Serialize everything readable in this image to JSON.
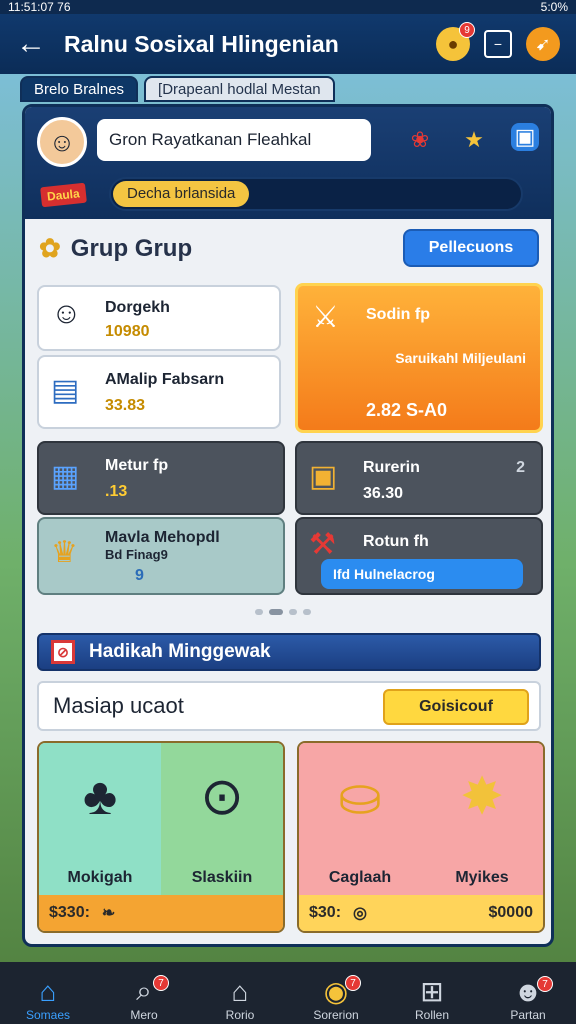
{
  "statusbar": {
    "left": "11:51:07 76",
    "right": "5:0%"
  },
  "appbar": {
    "title": "Ralnu Sosixal Hlingenian",
    "notif_count": "9"
  },
  "tabs": [
    "Brelo Bralnes",
    "[Drapeanl hodlal Mestan"
  ],
  "profile": {
    "name_value": "Gron Rayatkanan Fleahkal"
  },
  "status_pill": "Decha brlansida",
  "tag": "Daula",
  "group": {
    "title": "Grup Grup",
    "button": "Pellecuons"
  },
  "cards": {
    "c1": {
      "label": "Dorgekh",
      "value": "10980"
    },
    "c2": {
      "label": "AMalip Fabsarn",
      "value": "33.83"
    },
    "c3": {
      "label": "Sodin fp",
      "sub": "Saruikahl Miljeulani",
      "value": "2.82 S-A0"
    },
    "c4": {
      "label": "Metur fp",
      "value": ".13"
    },
    "c5": {
      "label": "Rurerin",
      "value": "36.30",
      "corner": "2"
    },
    "c6": {
      "label": "Mavla Mehopdl",
      "sub": "Bd Finag9",
      "value": "9"
    },
    "c7": {
      "label": "Rotun fh",
      "button": "Ifd Hulnelacrog"
    }
  },
  "weekly": {
    "title": "Hadikah Minggewak",
    "ready_label": "Masiap ucaot",
    "ready_button": "Goisicouf"
  },
  "shop": {
    "left": {
      "item1": "Mokigah",
      "item2": "Slaskiin",
      "price": "$330:"
    },
    "right": {
      "item1": "Caglaah",
      "item2": "Myikes",
      "price": "$30:",
      "price2": "$0000"
    }
  },
  "nav": [
    {
      "label": "Somaes",
      "icon": "home-icon",
      "badge": ""
    },
    {
      "label": "Mero",
      "icon": "search-icon",
      "badge": "7"
    },
    {
      "label": "Rorio",
      "icon": "house-icon",
      "badge": ""
    },
    {
      "label": "Sorerion",
      "icon": "compass-icon",
      "badge": "7"
    },
    {
      "label": "Rollen",
      "icon": "grid-icon",
      "badge": ""
    },
    {
      "label": "Partan",
      "icon": "person-icon",
      "badge": "7"
    }
  ]
}
